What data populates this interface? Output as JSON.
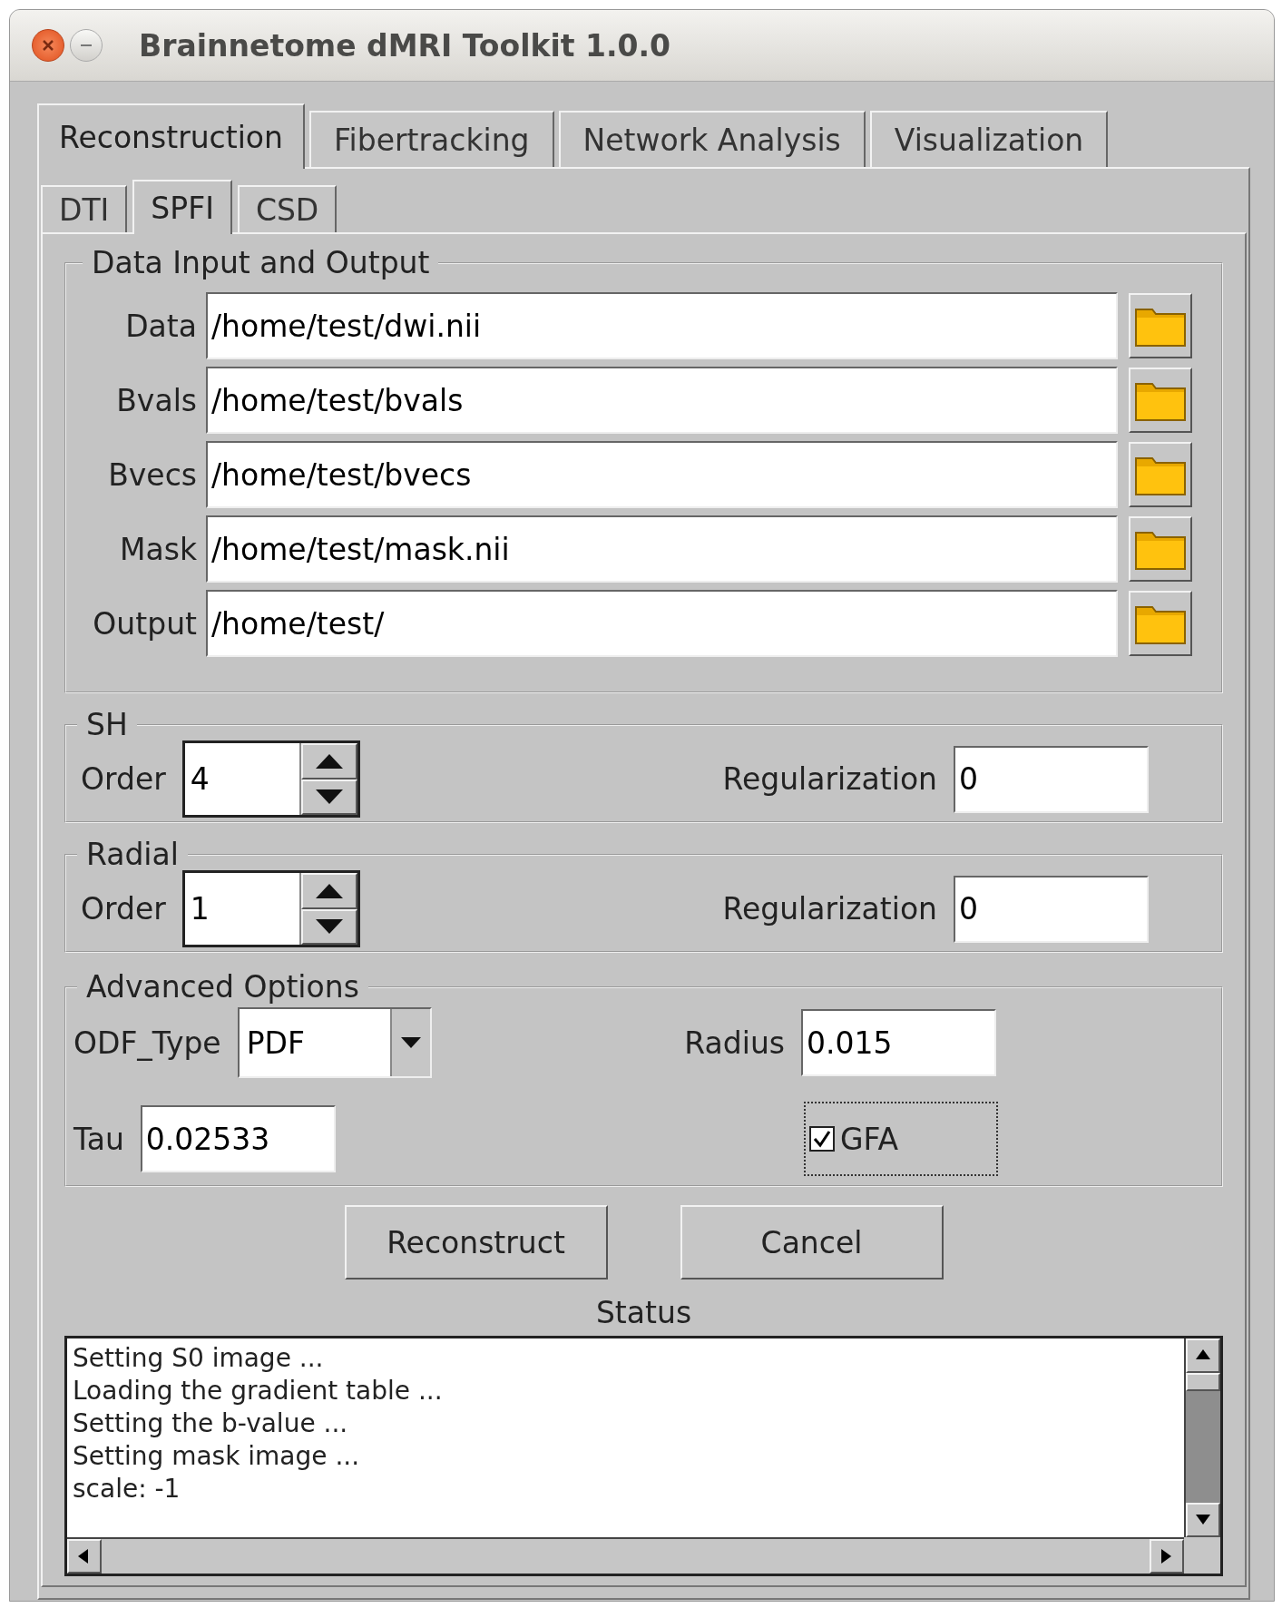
{
  "window": {
    "title": "Brainnetome dMRI Toolkit 1.0.0"
  },
  "tabs": [
    {
      "label": "Reconstruction",
      "selected": true
    },
    {
      "label": "Fibertracking",
      "selected": false
    },
    {
      "label": "Network Analysis",
      "selected": false
    },
    {
      "label": "Visualization",
      "selected": false
    }
  ],
  "subtabs": [
    {
      "label": "DTI",
      "selected": false
    },
    {
      "label": "SPFI",
      "selected": true
    },
    {
      "label": "CSD",
      "selected": false
    }
  ],
  "data_io": {
    "title": "Data Input and Output",
    "rows": [
      {
        "label": "Data",
        "value": "/home/test/dwi.nii"
      },
      {
        "label": "Bvals",
        "value": "/home/test/bvals"
      },
      {
        "label": "Bvecs",
        "value": "/home/test/bvecs"
      },
      {
        "label": "Mask",
        "value": "/home/test/mask.nii"
      },
      {
        "label": "Output",
        "value": "/home/test/"
      }
    ]
  },
  "sh": {
    "title": "SH",
    "order_label": "Order",
    "order": "4",
    "regularization_label": "Regularization",
    "regularization": "0"
  },
  "radial": {
    "title": "Radial",
    "order_label": "Order",
    "order": "1",
    "regularization_label": "Regularization",
    "regularization": "0"
  },
  "advanced": {
    "title": "Advanced Options",
    "odf_type_label": "ODF_Type",
    "odf_type": "PDF",
    "radius_label": "Radius",
    "radius": "0.015",
    "tau_label": "Tau",
    "tau": "0.02533",
    "gfa": {
      "label": "GFA",
      "checked": true
    }
  },
  "buttons": [
    "Reconstruct",
    "Cancel"
  ],
  "status": {
    "title": "Status",
    "lines": [
      "Setting S0 image ...",
      "Loading the gradient table ...",
      "Setting the b-value ...",
      "Setting mask image ...",
      "scale: -1"
    ]
  }
}
